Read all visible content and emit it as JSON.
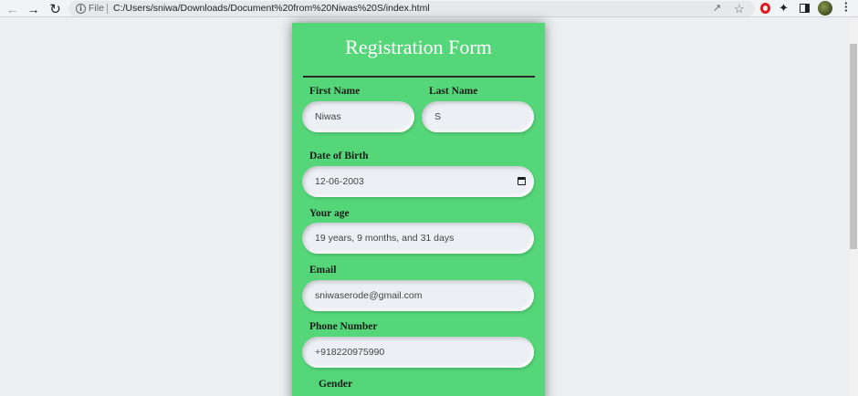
{
  "browser": {
    "scheme_label": "File",
    "url": "C:/Users/sniwa/Downloads/Document%20from%20Niwas%20S/index.html"
  },
  "form": {
    "title": "Registration Form",
    "first_name": {
      "label": "First Name",
      "value": "Niwas"
    },
    "last_name": {
      "label": "Last Name",
      "value": "S"
    },
    "dob": {
      "label": "Date of Birth",
      "value": "12-06-2003"
    },
    "age": {
      "label": "Your age",
      "value": "19 years, 9 months, and 31 days"
    },
    "email": {
      "label": "Email",
      "value": "sniwaserode@gmail.com"
    },
    "phone": {
      "label": "Phone Number",
      "value": "+918220975990"
    },
    "gender": {
      "label": "Gender"
    }
  }
}
